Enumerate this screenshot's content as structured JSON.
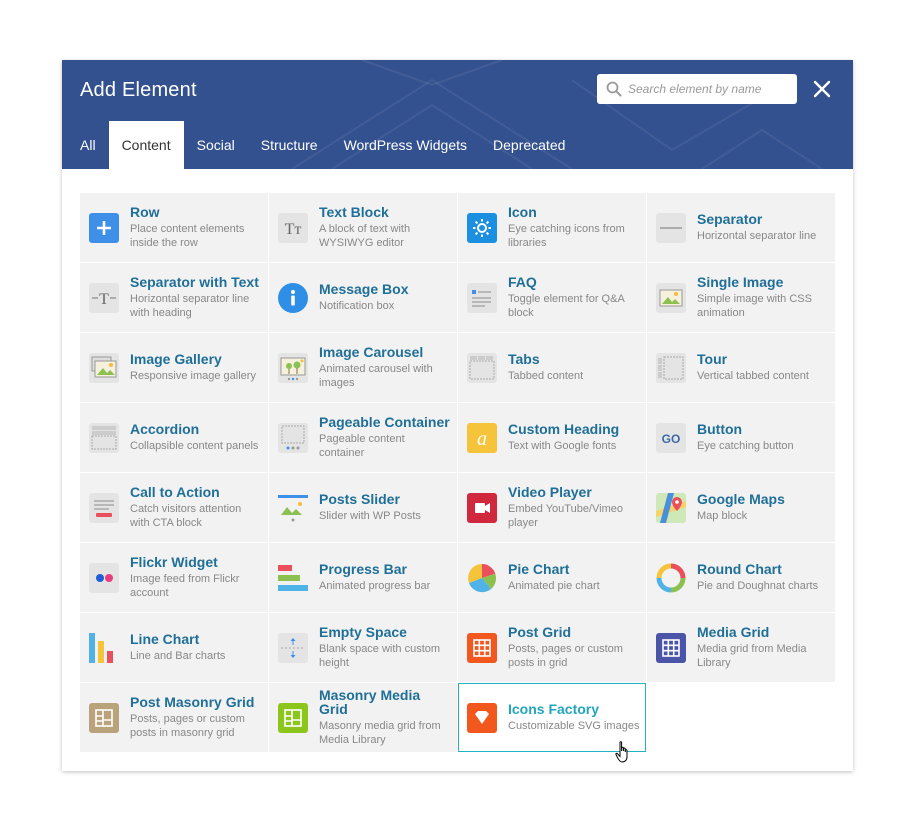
{
  "dialog": {
    "title": "Add Element",
    "search_placeholder": "Search element by name",
    "search_value": ""
  },
  "tabs": [
    {
      "label": "All",
      "active": false
    },
    {
      "label": "Content",
      "active": true
    },
    {
      "label": "Social",
      "active": false
    },
    {
      "label": "Structure",
      "active": false
    },
    {
      "label": "WordPress Widgets",
      "active": false
    },
    {
      "label": "Deprecated",
      "active": false
    }
  ],
  "elements": [
    {
      "name": "Row",
      "desc": "Place content elements inside the row",
      "icon": "plus-icon"
    },
    {
      "name": "Text Block",
      "desc": "A block of text with WYSIWYG editor",
      "icon": "text-block-icon"
    },
    {
      "name": "Icon",
      "desc": "Eye catching icons from libraries",
      "icon": "sun-icon"
    },
    {
      "name": "Separator",
      "desc": "Horizontal separator line",
      "icon": "separator-icon"
    },
    {
      "name": "Separator with Text",
      "desc": "Horizontal separator line with heading",
      "icon": "separator-text-icon"
    },
    {
      "name": "Message Box",
      "desc": "Notification box",
      "icon": "info-icon"
    },
    {
      "name": "FAQ",
      "desc": "Toggle element for Q&A block",
      "icon": "faq-icon"
    },
    {
      "name": "Single Image",
      "desc": "Simple image with CSS animation",
      "icon": "image-icon"
    },
    {
      "name": "Image Gallery",
      "desc": "Responsive image gallery",
      "icon": "gallery-icon"
    },
    {
      "name": "Image Carousel",
      "desc": "Animated carousel with images",
      "icon": "carousel-icon"
    },
    {
      "name": "Tabs",
      "desc": "Tabbed content",
      "icon": "tabs-icon"
    },
    {
      "name": "Tour",
      "desc": "Vertical tabbed content",
      "icon": "tour-icon"
    },
    {
      "name": "Accordion",
      "desc": "Collapsible content panels",
      "icon": "accordion-icon"
    },
    {
      "name": "Pageable Container",
      "desc": "Pageable content container",
      "icon": "pageable-icon"
    },
    {
      "name": "Custom Heading",
      "desc": "Text with Google fonts",
      "icon": "heading-icon",
      "glyph": "a"
    },
    {
      "name": "Button",
      "desc": "Eye catching button",
      "icon": "go-button-icon",
      "glyph": "GO"
    },
    {
      "name": "Call to Action",
      "desc": "Catch visitors attention with CTA block",
      "icon": "cta-icon"
    },
    {
      "name": "Posts Slider",
      "desc": "Slider with WP Posts",
      "icon": "posts-slider-icon"
    },
    {
      "name": "Video Player",
      "desc": "Embed YouTube/Vimeo player",
      "icon": "video-icon"
    },
    {
      "name": "Google Maps",
      "desc": "Map block",
      "icon": "map-icon"
    },
    {
      "name": "Flickr Widget",
      "desc": "Image feed from Flickr account",
      "icon": "flickr-icon"
    },
    {
      "name": "Progress Bar",
      "desc": "Animated progress bar",
      "icon": "progress-bar-icon"
    },
    {
      "name": "Pie Chart",
      "desc": "Animated pie chart",
      "icon": "pie-chart-icon"
    },
    {
      "name": "Round Chart",
      "desc": "Pie and Doughnat charts",
      "icon": "round-chart-icon"
    },
    {
      "name": "Line Chart",
      "desc": "Line and Bar charts",
      "icon": "bar-chart-icon"
    },
    {
      "name": "Empty Space",
      "desc": "Blank space with custom height",
      "icon": "empty-space-icon"
    },
    {
      "name": "Post Grid",
      "desc": "Posts, pages or custom posts in grid",
      "icon": "post-grid-icon"
    },
    {
      "name": "Media Grid",
      "desc": "Media grid from Media Library",
      "icon": "media-grid-icon"
    },
    {
      "name": "Post Masonry Grid",
      "desc": "Posts, pages or custom posts in masonry grid",
      "icon": "masonry-grid-icon"
    },
    {
      "name": "Masonry Media Grid",
      "desc": "Masonry media grid from Media Library",
      "icon": "masonry-media-icon"
    },
    {
      "name": "Icons Factory",
      "desc": "Customizable SVG images",
      "icon": "heart-shield-icon",
      "hovered": true
    }
  ],
  "colors": {
    "header": "#34518f",
    "title_text": "#1f6f98",
    "hover_border": "#23b1c6"
  }
}
